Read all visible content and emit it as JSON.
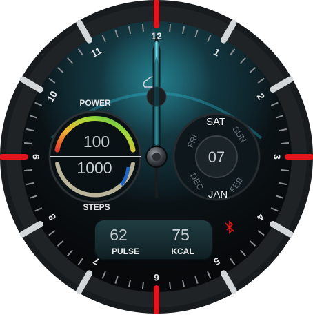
{
  "watch_face": {
    "hour_numerals": [
      "12",
      "1",
      "2",
      "3",
      "4",
      "5",
      "6",
      "7",
      "8",
      "9",
      "10",
      "11"
    ],
    "left_complication": {
      "top_label": "POWER",
      "top_value": "100",
      "bottom_value": "1000",
      "bottom_label": "STEPS",
      "power_ring_fraction": 1.0,
      "steps_ring_fraction": 1.0
    },
    "date_dial": {
      "days": [
        "FRI",
        "SAT",
        "SUN"
      ],
      "day_date": "07",
      "months": [
        "DEC",
        "JAN",
        "FEB"
      ],
      "selected_day": "SAT",
      "selected_month": "JAN"
    },
    "bottom_panel": {
      "pulse_value": "62",
      "pulse_label": "PULSE",
      "kcal_value": "75",
      "kcal_label": "KCAL"
    },
    "hands": {
      "hour_time": "12:00",
      "minute_time": "12:00",
      "second_at": "6"
    },
    "icons": [
      "weather-cloud-icon",
      "bluetooth-disconnected-icon"
    ],
    "colors": {
      "accent_red": "#e3141b",
      "accent_cyan": "#28d9f0",
      "bezel": "#181b1e",
      "panel_bg": "#16282c",
      "ring_gradient": [
        "#e33a2c",
        "#f2b233",
        "#a3d93a",
        "#37b24d"
      ]
    }
  }
}
